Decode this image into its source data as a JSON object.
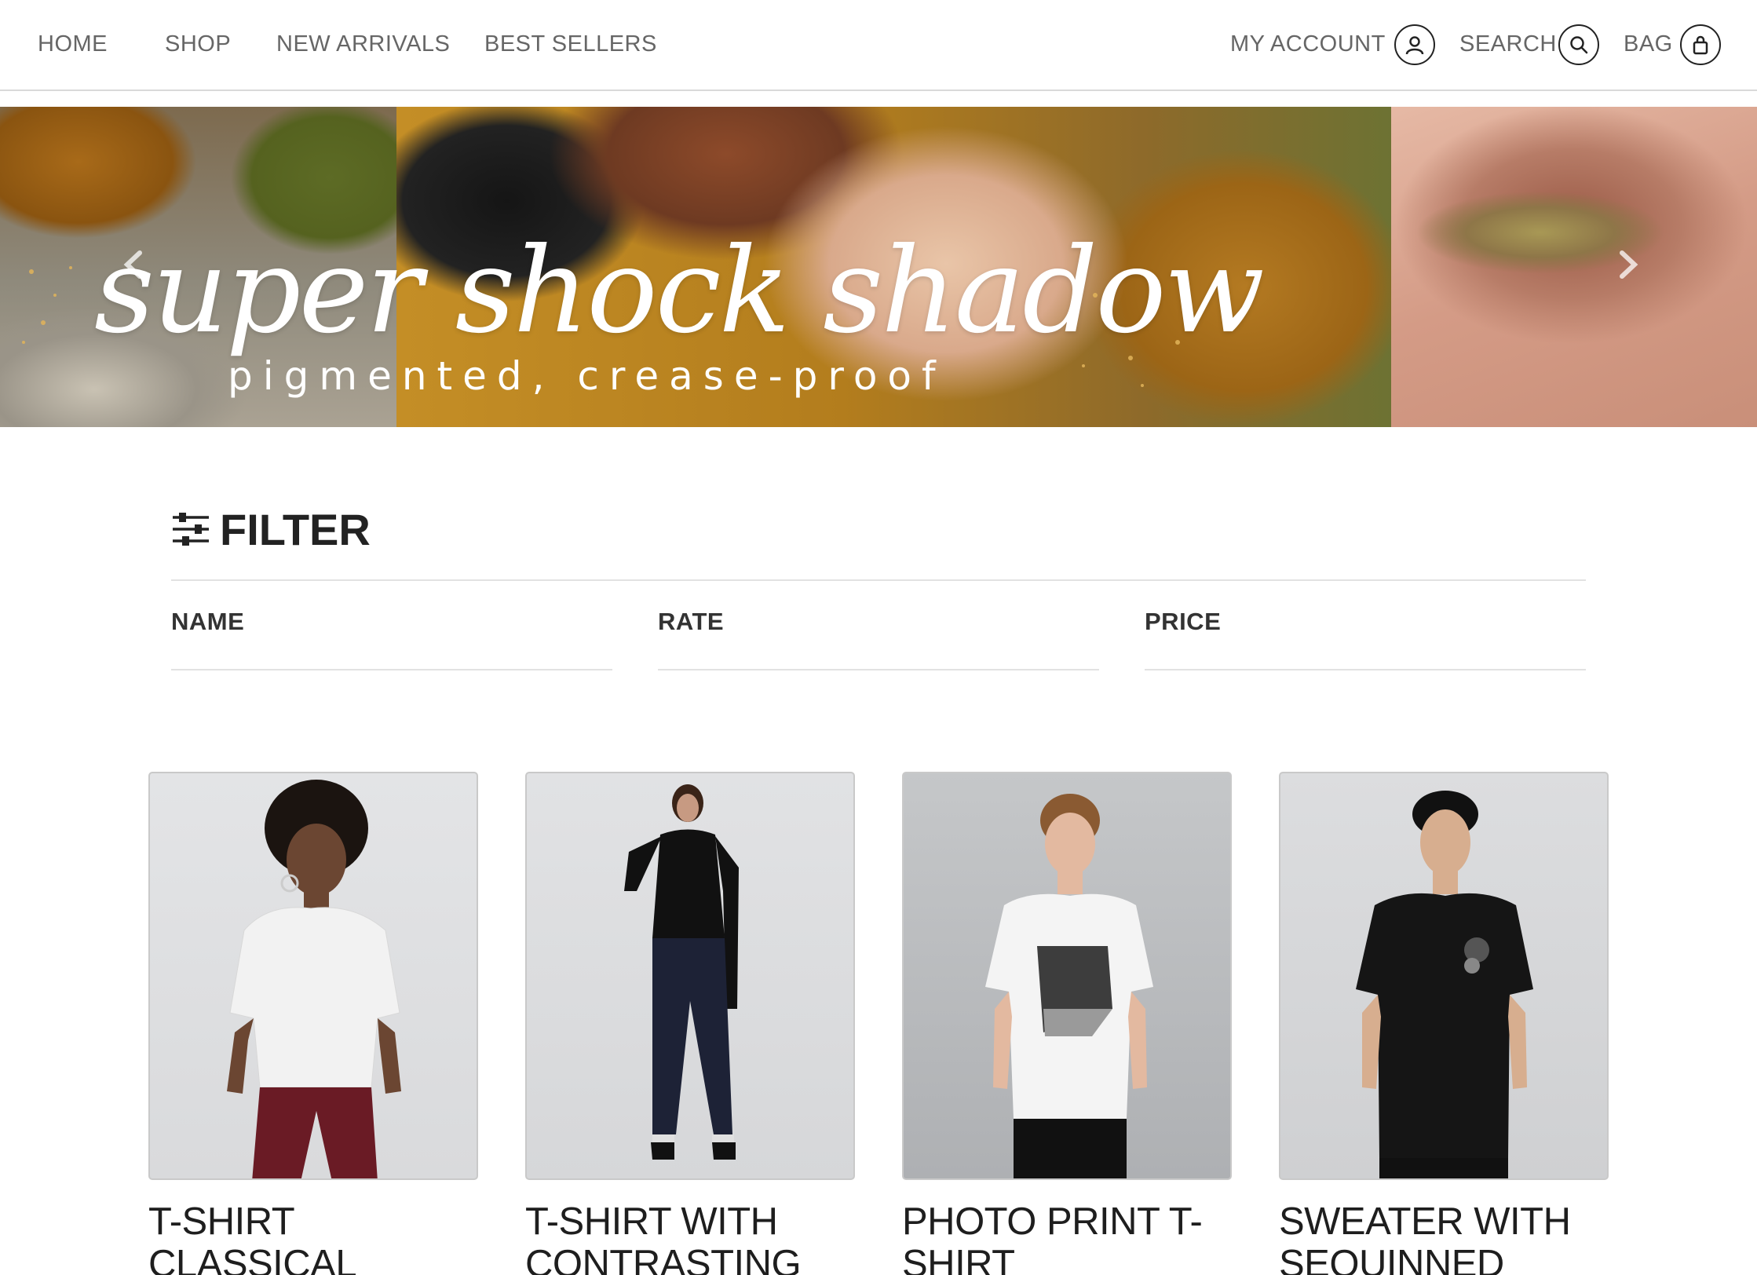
{
  "nav": {
    "left_links": [
      "HOME",
      "SHOP",
      "NEW ARRIVALS",
      "BEST SELLERS"
    ],
    "account_label": "MY ACCOUNT",
    "search_label": "SEARCH",
    "bag_label": "BAG"
  },
  "hero": {
    "title": "super shock shadow",
    "subtitle": "pigmented, crease-proof"
  },
  "filter": {
    "heading": "FILTER",
    "fields": [
      "NAME",
      "RATE",
      "PRICE"
    ]
  },
  "products": [
    {
      "title": "T-SHIRT CLASSICAL"
    },
    {
      "title": "T-SHIRT WITH CONTRASTING"
    },
    {
      "title": "PHOTO PRINT T-SHIRT"
    },
    {
      "title": "SWEATER WITH SEQUINNED"
    }
  ],
  "colors": {
    "text": "#222222",
    "nav_text": "#666666",
    "rule": "#e2e2e2"
  }
}
